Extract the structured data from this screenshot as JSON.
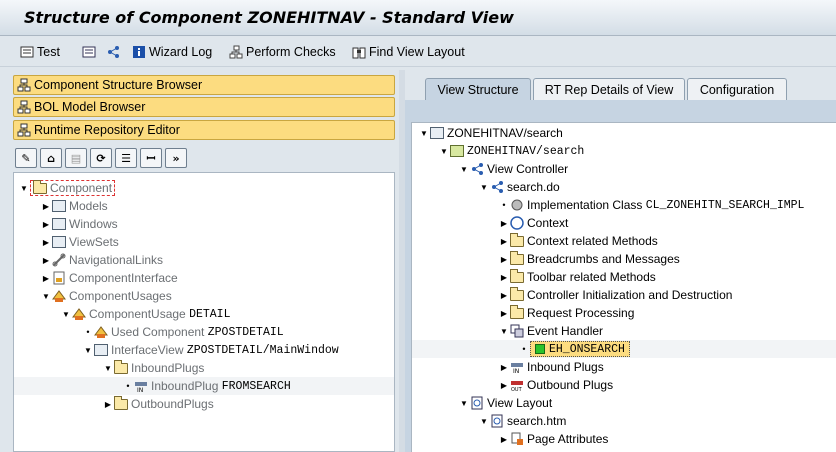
{
  "window": {
    "title": "Structure of Component ZONEHITNAV - Standard View"
  },
  "toolbar": {
    "test_label": "Test",
    "wizard_log_label": "Wizard Log",
    "perform_checks_label": "Perform Checks",
    "find_view_layout_label": "Find View Layout"
  },
  "left_panel": {
    "browsers": [
      "Component Structure Browser",
      "BOL Model Browser",
      "Runtime Repository Editor"
    ],
    "tree": {
      "component": "Component",
      "models": "Models",
      "windows": "Windows",
      "viewsets": "ViewSets",
      "navigational_links": "NavigationalLinks",
      "component_interface": "ComponentInterface",
      "component_usages": "ComponentUsages",
      "usage_label": "ComponentUsage",
      "usage_value": "DETAIL",
      "used_component_label": "Used Component",
      "used_component_value": "ZPOSTDETAIL",
      "interface_view_label": "InterfaceView",
      "interface_view_value": "ZPOSTDETAIL/MainWindow",
      "inbound_plugs": "InboundPlugs",
      "inbound_plug_label": "InboundPlug",
      "inbound_plug_value": "FROMSEARCH",
      "outbound_plugs": "OutboundPlugs"
    }
  },
  "right_panel": {
    "tabs": [
      "View Structure",
      "RT Rep Details of View",
      "Configuration"
    ],
    "active_tab": "View Structure",
    "tree": {
      "root": "ZONEHITNAV/search",
      "view": "ZONEHITNAV/search",
      "view_controller": "View Controller",
      "search_do": "search.do",
      "impl_class_label": "Implementation Class",
      "impl_class_value": "CL_ZONEHITN_SEARCH_IMPL",
      "context": "Context",
      "context_methods": "Context related Methods",
      "breadcrumbs": "Breadcrumbs and Messages",
      "toolbar_methods": "Toolbar related Methods",
      "controller_init": "Controller Initialization and Destruction",
      "request_processing": "Request Processing",
      "event_handler": "Event Handler",
      "eh_onsearch": "EH_ONSEARCH",
      "inbound_plugs": "Inbound Plugs",
      "outbound_plugs": "Outbound Plugs",
      "view_layout": "View Layout",
      "search_htm": "search.htm",
      "page_attributes": "Page Attributes"
    }
  }
}
